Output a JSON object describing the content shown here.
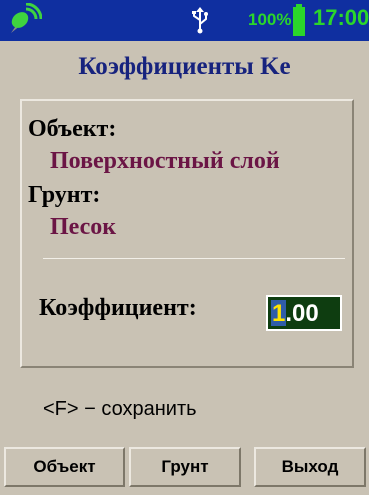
{
  "status_bar": {
    "battery_percent": "100%",
    "battery_level": 1.0,
    "time": "17:00",
    "icons": [
      "satellite-icon",
      "usb-icon",
      "battery-icon"
    ],
    "background": "#0f2fa0",
    "accent": "#2bd62b"
  },
  "screen": {
    "title": "Коэффициенты Ke"
  },
  "fields": {
    "object_label": "Объект:",
    "object_value": "Поверхностный слой",
    "soil_label": "Грунт:",
    "soil_value": "Песок",
    "coef_label": "Коэффициент:",
    "coef_value_first": "1",
    "coef_value_rest": ".00"
  },
  "hint": "<F> − сохранить",
  "buttons": {
    "object": "Объект",
    "soil": "Грунт",
    "exit": "Выход"
  },
  "colors": {
    "title": "#17237e",
    "value": "#6b1545",
    "background": "#c9c2b4"
  }
}
